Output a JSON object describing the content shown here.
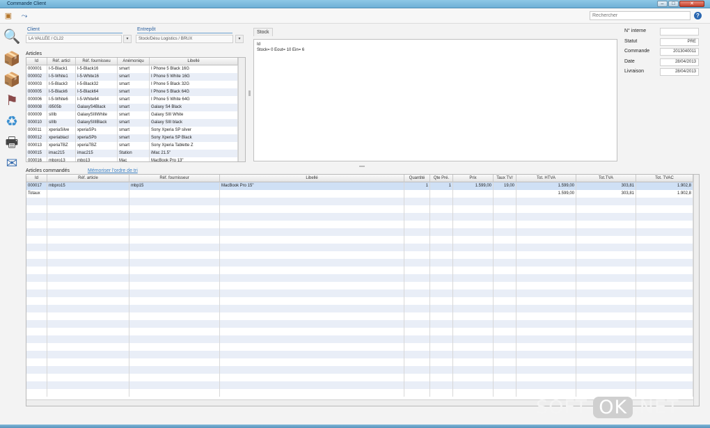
{
  "window": {
    "title": "Commande Client"
  },
  "toolbar": {
    "search_placeholder": "Rechercher",
    "help": "?"
  },
  "client": {
    "label": "Client",
    "value": "LA VALLÉE / CL22"
  },
  "entrepot": {
    "label": "Entrepôt",
    "value": "Stock/Désu Logistics / BRUX"
  },
  "articles": {
    "title": "Articles",
    "headers": [
      "Id",
      "Réf. articl",
      "Réf. fournisseu",
      "Anémoniqu",
      "Libellé"
    ],
    "rows": [
      [
        "000001",
        "I-5-Black1",
        "I-5-Black16",
        "smart",
        "I Phone 5 Black 16G"
      ],
      [
        "000002",
        "I-5-White1",
        "I-5-White16",
        "smart",
        "I Phone 5 White 16G"
      ],
      [
        "000003",
        "I-5-Black3",
        "I-5-Black32",
        "smart",
        "I Phone 5 Black 32G"
      ],
      [
        "000005",
        "I-5-Black6",
        "I-5-Black64",
        "smart",
        "I Phone 5 Black 64G"
      ],
      [
        "000006",
        "I-5-White6",
        "I-5-White64",
        "smart",
        "I Phone 5 White 64G"
      ],
      [
        "000008",
        "i9505b",
        "GalaxyS4Black",
        "smart",
        "Galaxy S4 Black"
      ],
      [
        "000009",
        "sIIIb",
        "GalaxySIIIWhite",
        "smart",
        "Galaxy SIII White"
      ],
      [
        "000010",
        "sIIIb",
        "GalaxySIIIBlack",
        "smart",
        "Galaxy SIII black"
      ],
      [
        "000011",
        "xperiaSilve",
        "xperiaSPs",
        "smart",
        "Sony Xperia SP silver"
      ],
      [
        "000012",
        "xperiablacl",
        "xperiaSPb",
        "smart",
        "Sony Xperia SP Black"
      ],
      [
        "000013",
        "xperiaTBZ",
        "xperiaTBZ",
        "smart",
        "Sony Xperia Tablette Z"
      ],
      [
        "000015",
        "imac215",
        "imac215",
        "Station",
        "iMac 21.5\""
      ],
      [
        "000016",
        "mbpro13",
        "mbp13",
        "Mac",
        "MacBook Pro 13\""
      ]
    ]
  },
  "stock": {
    "tab": "Stock",
    "line1": "Id",
    "line2": "Stock= 0 Eout= 10 Ein= 6"
  },
  "info": {
    "fields": [
      {
        "label": "N° interne",
        "value": ""
      },
      {
        "label": "Statut",
        "value": "PRE"
      },
      {
        "label": "Commande",
        "value": "2013040011"
      },
      {
        "label": "Date",
        "value": "28/04/2013"
      },
      {
        "label": "Livraison",
        "value": "28/04/2013"
      }
    ]
  },
  "commandes": {
    "title": "Articles commandés",
    "link": "Mémoriser l'ordre de tri",
    "headers": [
      "Id",
      "Réf. article",
      "Réf. fournisseur",
      "Libellé",
      "Quantité",
      "Qte Pré.",
      "Prix",
      "Taux TV/",
      "Tot. HTVA",
      "Tot.TVA",
      "Tot. TVAC"
    ],
    "row": [
      "000017",
      "mbpro15",
      "mbp15",
      "MacBook Pro 15\"",
      "1",
      "1",
      "1.599,00",
      "19,00",
      "1.599,00",
      "303,81",
      "1.902,8"
    ],
    "totals": {
      "label": "Totaux",
      "htva": "1.599,00",
      "tva": "303,81",
      "tvac": "1.902,8"
    }
  },
  "watermark": {
    "left": "SOFT-",
    "ok": "OK",
    "right": ".NET"
  }
}
